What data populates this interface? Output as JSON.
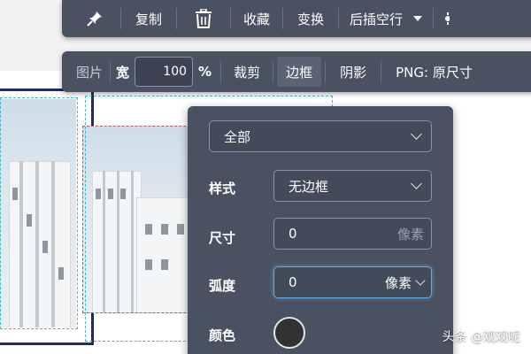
{
  "toolbar_top": {
    "pin_icon": "pushpin-icon",
    "copy": "复制",
    "delete_icon": "trash-icon",
    "favorite": "收藏",
    "transform": "变换",
    "insert_after": "后插空行",
    "settings_icon": "partial-icon"
  },
  "toolbar_image": {
    "image": "图片",
    "width_label": "宽",
    "width_value": "100",
    "percent": "%",
    "crop": "裁剪",
    "border": "边框",
    "shadow": "阴影",
    "format": "PNG: 原尺寸"
  },
  "border_panel": {
    "scope": "全部",
    "style_label": "样式",
    "style_value": "无边框",
    "size_label": "尺寸",
    "size_value": "0",
    "size_unit": "像素",
    "radius_label": "弧度",
    "radius_value": "0",
    "radius_unit": "像素",
    "color_label": "颜色",
    "color_value": "#323232"
  },
  "watermark": "头条 @观观呢",
  "colors": {
    "toolbar_bg": "#4a5161",
    "focus_accent": "#6aa6e0"
  }
}
